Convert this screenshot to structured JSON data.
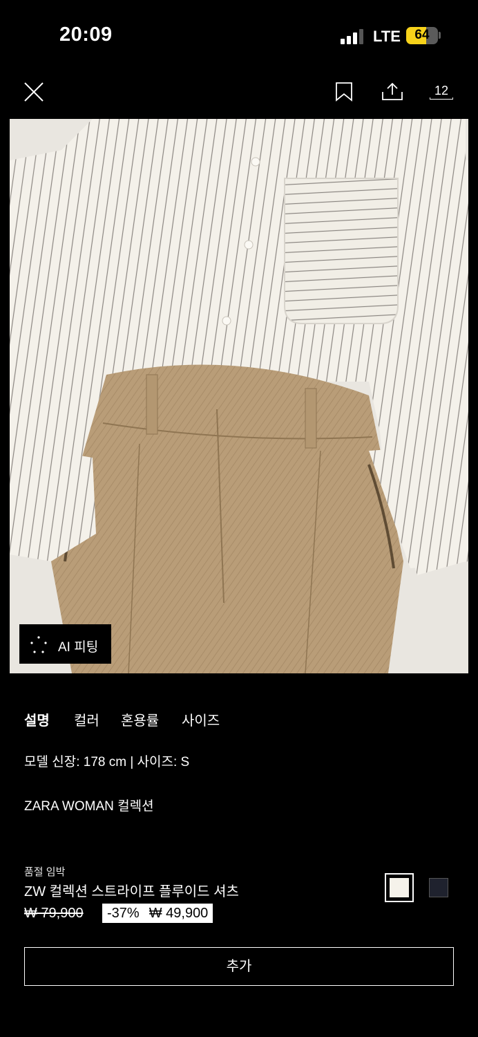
{
  "status_bar": {
    "time": "20:09",
    "network": "LTE",
    "battery_level": "64",
    "signal_bars_active": 3,
    "battery_color": "#f7d21a"
  },
  "top_nav": {
    "close_icon": "close-icon",
    "bookmark_icon": "bookmark-icon",
    "share_icon": "share-icon",
    "image_count": "12"
  },
  "product_image": {
    "ai_fitting_label": "AI 피팅"
  },
  "tabs": [
    {
      "label": "설명",
      "active": true
    },
    {
      "label": "컬러",
      "active": false
    },
    {
      "label": "혼용률",
      "active": false
    },
    {
      "label": "사이즈",
      "active": false
    }
  ],
  "description": {
    "model_info": "모델 신장: 178 cm | 사이즈: S",
    "collection": "ZARA WOMAN 컬렉션"
  },
  "product": {
    "stock_notice": "품절 임박",
    "name": "ZW 컬렉션 스트라이프 플루이드 셔츠",
    "original_price": "₩ 79,900",
    "discount": "-37%",
    "sale_price": "₩ 49,900",
    "colors": [
      "#f5f2ea",
      "#1f222e"
    ],
    "selected_color_index": 0
  },
  "add_button": {
    "label": "추가"
  }
}
